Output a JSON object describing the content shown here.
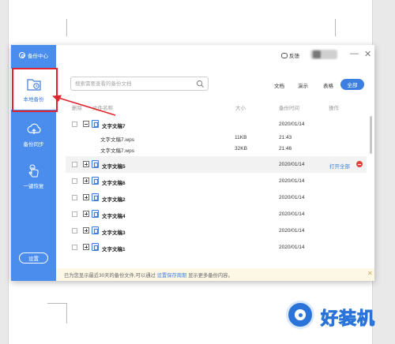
{
  "sidebar": {
    "header": "备份中心",
    "items": [
      {
        "label": "本地备份",
        "icon": "folder-clock-icon",
        "active": true
      },
      {
        "label": "备份同步",
        "icon": "cloud-upload-icon",
        "active": false
      },
      {
        "label": "一键恢复",
        "icon": "hand-tap-icon",
        "active": false
      }
    ],
    "settings": "设置"
  },
  "topbar": {
    "feedback": "反馈",
    "minimize": "—",
    "close": "✕"
  },
  "search": {
    "placeholder": "搜索需要查看的备份文档"
  },
  "tabs": [
    "文档",
    "演示",
    "表格",
    "全部"
  ],
  "columns": {
    "delete": "删除",
    "name": "文件名称",
    "size": "大小",
    "time": "备份时间",
    "ops": "操作"
  },
  "rows": [
    {
      "name": "文字文稿7",
      "time": "2020/01/14",
      "expanded": true
    },
    {
      "name": "文字文稿5",
      "time": "2020/01/14",
      "op": "打开全部"
    },
    {
      "name": "文字文稿6",
      "time": "2020/01/14"
    },
    {
      "name": "文字文稿2",
      "time": "2020/01/14"
    },
    {
      "name": "文字文稿4",
      "time": "2020/01/14"
    },
    {
      "name": "文字文稿3",
      "time": "2020/01/14"
    },
    {
      "name": "文字文稿1",
      "time": "2020/01/14"
    }
  ],
  "subrows": [
    {
      "name": "文字文稿7.wps",
      "size": "11KB",
      "time": "21:43"
    },
    {
      "name": "文字文稿7.wps",
      "size": "32KB",
      "time": "21:46"
    }
  ],
  "footer": {
    "text1": "已为您显示最近30天的备份文件,可以通过",
    "link": "设置保存周期",
    "text2": "显示更多备份内容。",
    "close": "✕"
  },
  "watermark": "好装机",
  "colors": {
    "accent": "#4a8ded",
    "highlight": "#e0242d"
  }
}
